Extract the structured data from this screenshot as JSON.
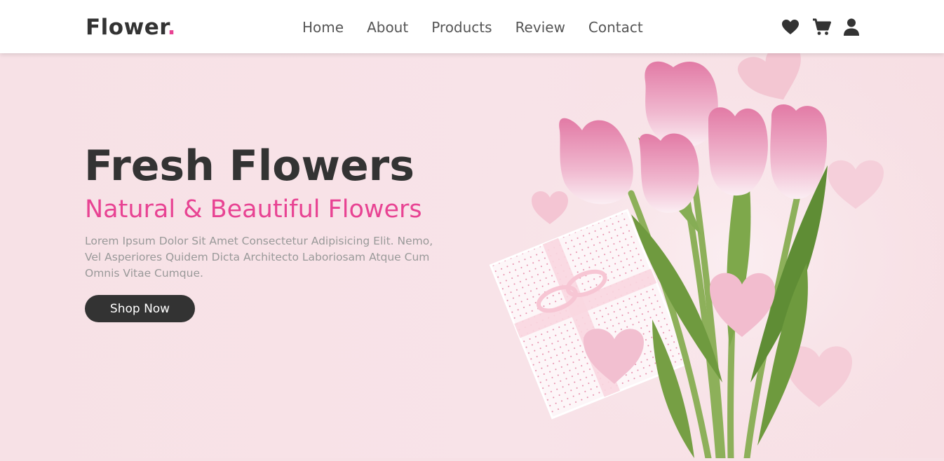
{
  "header": {
    "logo_text": "Flower",
    "logo_dot": ".",
    "nav": [
      {
        "label": "Home"
      },
      {
        "label": "About"
      },
      {
        "label": "Products"
      },
      {
        "label": "Review"
      },
      {
        "label": "Contact"
      }
    ],
    "icons": [
      "heart-icon",
      "cart-icon",
      "user-icon"
    ]
  },
  "hero": {
    "title": "Fresh Flowers",
    "subtitle": "Natural & Beautiful Flowers",
    "description": "Lorem Ipsum Dolor Sit Amet Consectetur Adipisicing Elit. Nemo, Vel Asperiores Quidem Dicta Architecto Laboriosam Atque Cum Omnis Vitae Cumque.",
    "button_label": "Shop Now"
  },
  "colors": {
    "accent": "#e84393",
    "dark": "#333333",
    "background": "#f7e1e6"
  }
}
